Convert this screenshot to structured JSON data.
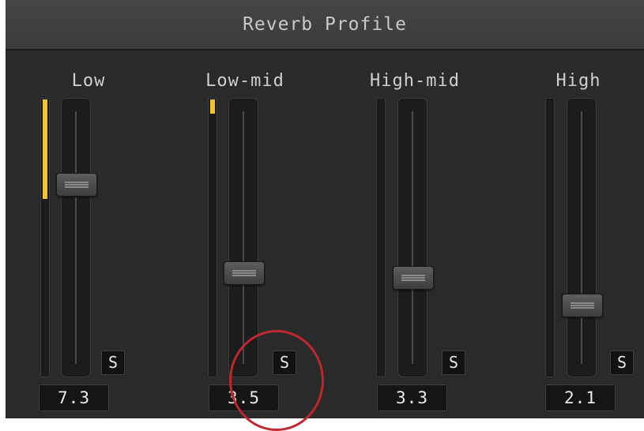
{
  "panel": {
    "title": "Reverb Profile",
    "accent_color": "#f2c230"
  },
  "channels": [
    {
      "label": "Low",
      "value": "7.3",
      "solo_label": "S",
      "slider_level": 0.73,
      "meter_level": 0.36
    },
    {
      "label": "Low-mid",
      "value": "3.5",
      "solo_label": "S",
      "slider_level": 0.35,
      "meter_level": 0.05
    },
    {
      "label": "High-mid",
      "value": "3.3",
      "solo_label": "S",
      "slider_level": 0.33,
      "meter_level": 0.0
    },
    {
      "label": "High",
      "value": "2.1",
      "solo_label": "S",
      "slider_level": 0.21,
      "meter_level": 0.0
    }
  ],
  "annotation": {
    "shape": "circle",
    "color": "#c0272d"
  }
}
